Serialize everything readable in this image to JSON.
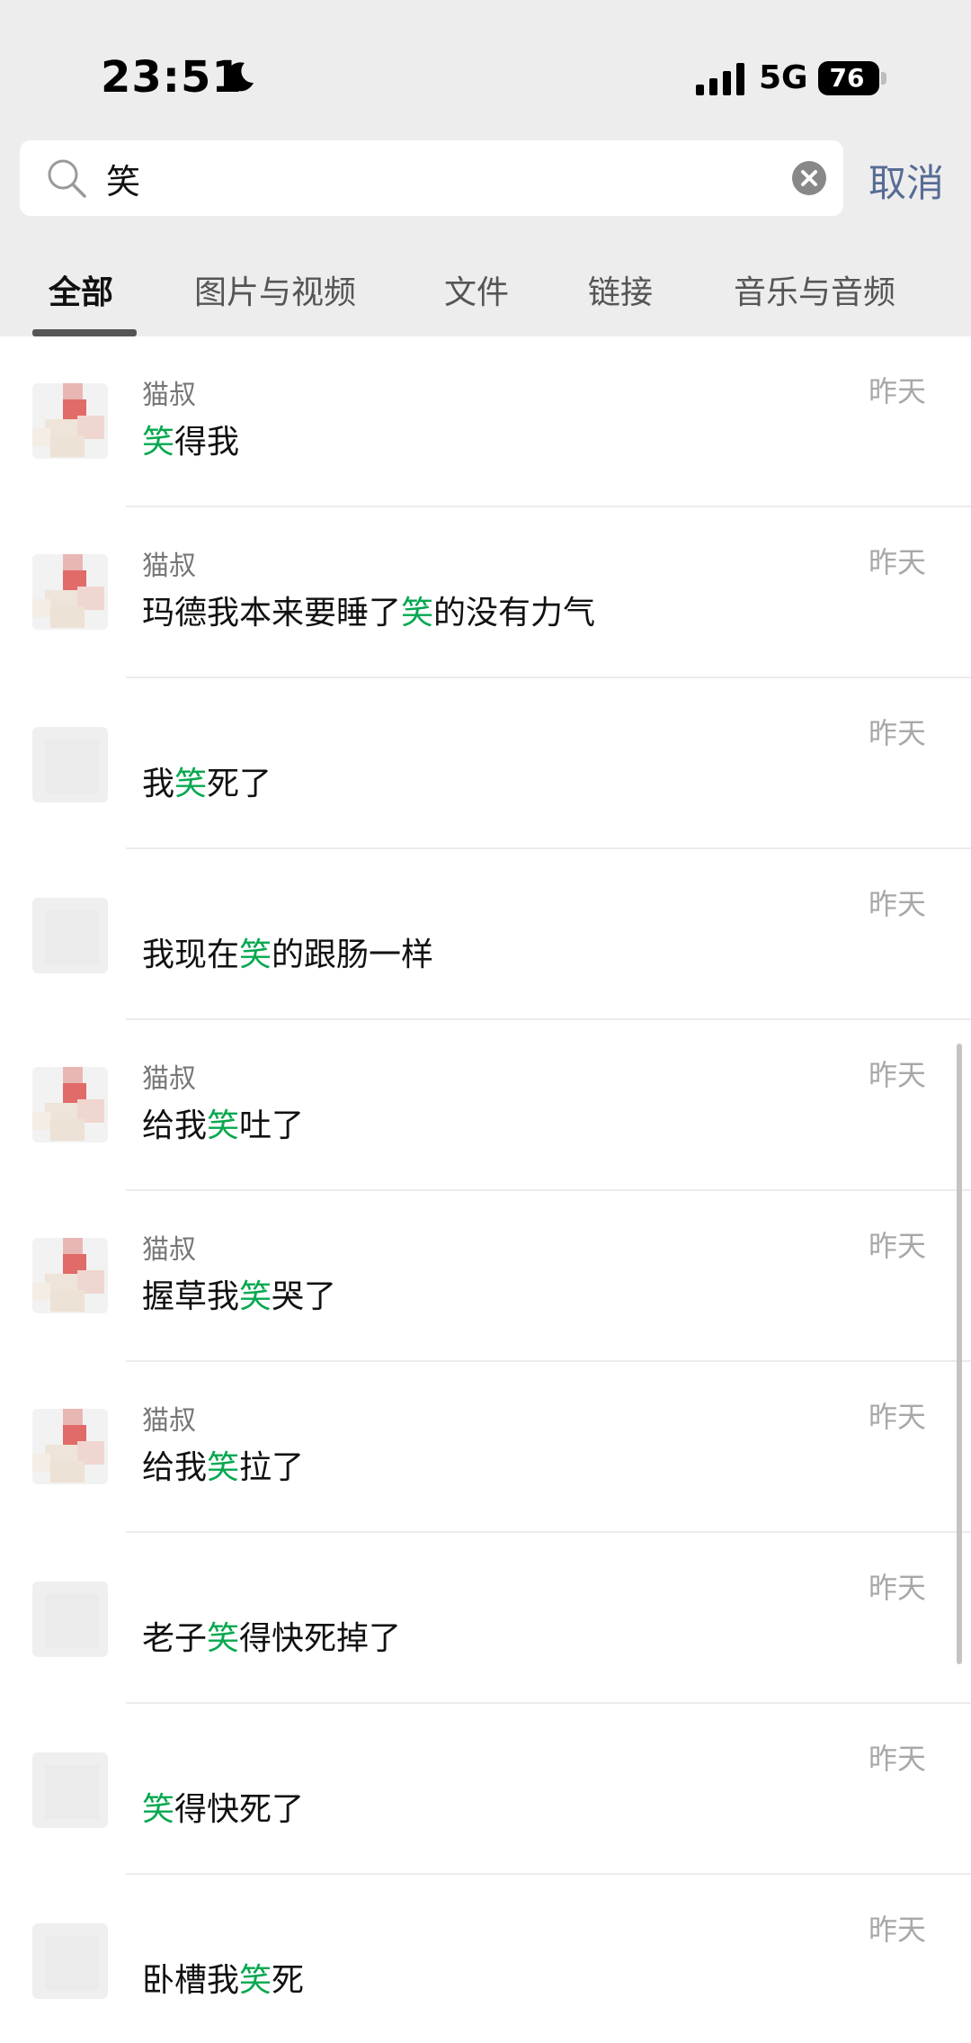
{
  "status_bar": {
    "time": "23:51",
    "network": "5G",
    "battery": "76"
  },
  "search": {
    "query": "笑",
    "cancel_label": "取消"
  },
  "tabs": [
    "全部",
    "图片与视频",
    "文件",
    "链接",
    "音乐与音频"
  ],
  "results": [
    {
      "sender": "猫叔",
      "parts": [
        {
          "t": "笑",
          "hl": true
        },
        {
          "t": "得我",
          "hl": false
        }
      ],
      "date": "昨天",
      "avatar": "pink"
    },
    {
      "sender": "猫叔",
      "parts": [
        {
          "t": "玛德我本来要睡了",
          "hl": false
        },
        {
          "t": "笑",
          "hl": true
        },
        {
          "t": "的没有力气",
          "hl": false
        }
      ],
      "date": "昨天",
      "avatar": "pink"
    },
    {
      "sender": "",
      "parts": [
        {
          "t": "我",
          "hl": false
        },
        {
          "t": "笑",
          "hl": true
        },
        {
          "t": "死了",
          "hl": false
        }
      ],
      "date": "昨天",
      "avatar": "gray"
    },
    {
      "sender": "",
      "parts": [
        {
          "t": "我现在",
          "hl": false
        },
        {
          "t": "笑",
          "hl": true
        },
        {
          "t": "的跟肠一样",
          "hl": false
        }
      ],
      "date": "昨天",
      "avatar": "gray"
    },
    {
      "sender": "猫叔",
      "parts": [
        {
          "t": "给我",
          "hl": false
        },
        {
          "t": "笑",
          "hl": true
        },
        {
          "t": "吐了",
          "hl": false
        }
      ],
      "date": "昨天",
      "avatar": "pink"
    },
    {
      "sender": "猫叔",
      "parts": [
        {
          "t": "握草我",
          "hl": false
        },
        {
          "t": "笑",
          "hl": true
        },
        {
          "t": "哭了",
          "hl": false
        }
      ],
      "date": "昨天",
      "avatar": "pink"
    },
    {
      "sender": "猫叔",
      "parts": [
        {
          "t": "给我",
          "hl": false
        },
        {
          "t": "笑",
          "hl": true
        },
        {
          "t": "拉了",
          "hl": false
        }
      ],
      "date": "昨天",
      "avatar": "pink"
    },
    {
      "sender": "",
      "parts": [
        {
          "t": "老子",
          "hl": false
        },
        {
          "t": "笑",
          "hl": true
        },
        {
          "t": "得快死掉了",
          "hl": false
        }
      ],
      "date": "昨天",
      "avatar": "gray"
    },
    {
      "sender": "",
      "parts": [
        {
          "t": "笑",
          "hl": true
        },
        {
          "t": "得快死了",
          "hl": false
        }
      ],
      "date": "昨天",
      "avatar": "gray"
    },
    {
      "sender": "",
      "parts": [
        {
          "t": "卧槽我",
          "hl": false
        },
        {
          "t": "笑",
          "hl": true
        },
        {
          "t": "死",
          "hl": false
        }
      ],
      "date": "昨天",
      "avatar": "gray"
    }
  ],
  "colors": {
    "highlight": "#07a84f",
    "link": "#576b95",
    "header_bg": "#ededed"
  },
  "icons": [
    "moon-icon",
    "signal-icon",
    "battery-icon",
    "search-icon",
    "clear-icon"
  ]
}
